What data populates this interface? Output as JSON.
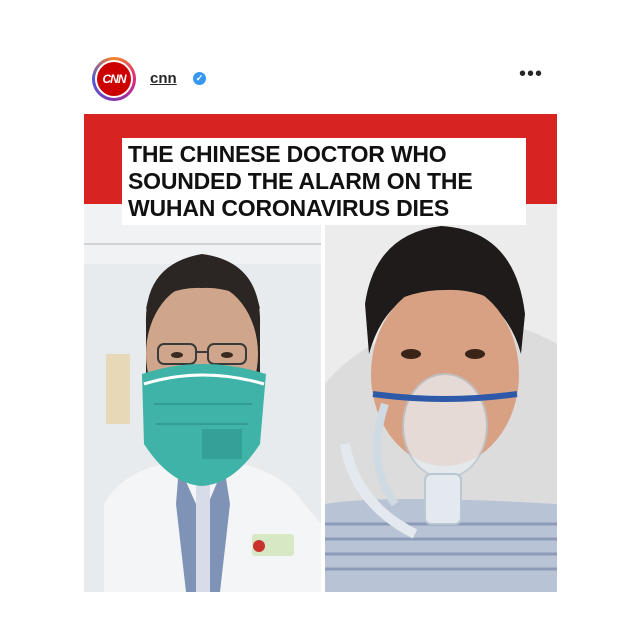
{
  "post": {
    "username": "cnn",
    "avatar_label": "CNN",
    "verified_icon": "verified-badge-icon",
    "more_label": "•••"
  },
  "image": {
    "headline_lines": [
      "THE CHINESE DOCTOR WHO",
      "SOUNDED THE ALARM ON THE",
      "WUHAN CORONAVIRUS DIES"
    ],
    "left_photo": "doctor-in-mask-photo",
    "right_photo": "doctor-in-oxygen-mask-photo",
    "colors": {
      "banner": "#d82420",
      "mask": "#3fb3a7"
    }
  }
}
